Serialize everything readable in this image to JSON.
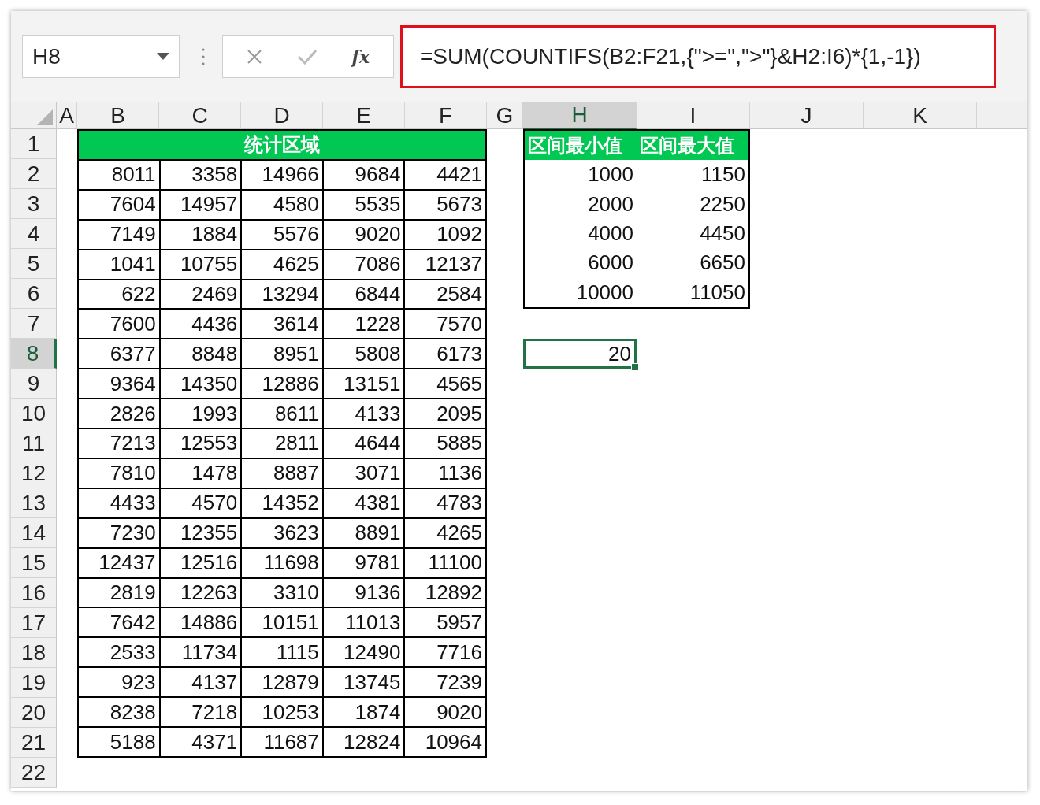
{
  "name_box": {
    "value": "H8"
  },
  "formula_bar": {
    "function_label": "fx",
    "formula": "=SUM(COUNTIFS(B2:F21,{\">=\",\">\"}&H2:I6)*{1,-1})",
    "highlighted": true
  },
  "columns": [
    {
      "label": "A",
      "selected": false
    },
    {
      "label": "B",
      "selected": false
    },
    {
      "label": "C",
      "selected": false
    },
    {
      "label": "D",
      "selected": false
    },
    {
      "label": "E",
      "selected": false
    },
    {
      "label": "F",
      "selected": false
    },
    {
      "label": "G",
      "selected": false
    },
    {
      "label": "H",
      "selected": true
    },
    {
      "label": "I",
      "selected": false
    },
    {
      "label": "J",
      "selected": false
    },
    {
      "label": "K",
      "selected": false
    }
  ],
  "rows": [
    {
      "label": "1",
      "selected": false
    },
    {
      "label": "2",
      "selected": false
    },
    {
      "label": "3",
      "selected": false
    },
    {
      "label": "4",
      "selected": false
    },
    {
      "label": "5",
      "selected": false
    },
    {
      "label": "6",
      "selected": false
    },
    {
      "label": "7",
      "selected": false
    },
    {
      "label": "8",
      "selected": true
    },
    {
      "label": "9",
      "selected": false
    },
    {
      "label": "10",
      "selected": false
    },
    {
      "label": "11",
      "selected": false
    },
    {
      "label": "12",
      "selected": false
    },
    {
      "label": "13",
      "selected": false
    },
    {
      "label": "14",
      "selected": false
    },
    {
      "label": "15",
      "selected": false
    },
    {
      "label": "16",
      "selected": false
    },
    {
      "label": "17",
      "selected": false
    },
    {
      "label": "18",
      "selected": false
    },
    {
      "label": "19",
      "selected": false
    },
    {
      "label": "20",
      "selected": false
    },
    {
      "label": "21",
      "selected": false
    },
    {
      "label": "22",
      "selected": false
    }
  ],
  "data_table": {
    "title": "统计区域",
    "rows": [
      [
        "8011",
        "3358",
        "14966",
        "9684",
        "4421"
      ],
      [
        "7604",
        "14957",
        "4580",
        "5535",
        "5673"
      ],
      [
        "7149",
        "1884",
        "5576",
        "9020",
        "1092"
      ],
      [
        "1041",
        "10755",
        "4625",
        "7086",
        "12137"
      ],
      [
        "622",
        "2469",
        "13294",
        "6844",
        "2584"
      ],
      [
        "7600",
        "4436",
        "3614",
        "1228",
        "7570"
      ],
      [
        "6377",
        "8848",
        "8951",
        "5808",
        "6173"
      ],
      [
        "9364",
        "14350",
        "12886",
        "13151",
        "4565"
      ],
      [
        "2826",
        "1993",
        "8611",
        "4133",
        "2095"
      ],
      [
        "7213",
        "12553",
        "2811",
        "4644",
        "5885"
      ],
      [
        "7810",
        "1478",
        "8887",
        "3071",
        "1136"
      ],
      [
        "4433",
        "4570",
        "14352",
        "4381",
        "4783"
      ],
      [
        "7230",
        "12355",
        "3623",
        "8891",
        "4265"
      ],
      [
        "12437",
        "12516",
        "11698",
        "9781",
        "11100"
      ],
      [
        "2819",
        "12263",
        "3310",
        "9136",
        "12892"
      ],
      [
        "7642",
        "14886",
        "10151",
        "11013",
        "5957"
      ],
      [
        "2533",
        "11734",
        "1115",
        "12490",
        "7716"
      ],
      [
        "923",
        "4137",
        "12879",
        "13745",
        "7239"
      ],
      [
        "8238",
        "7218",
        "10253",
        "1874",
        "9020"
      ],
      [
        "5188",
        "4371",
        "11687",
        "12824",
        "10964"
      ]
    ]
  },
  "range_table": {
    "columns": [
      "区间最小值",
      "区间最大值"
    ],
    "rows": [
      [
        "1000",
        "1150"
      ],
      [
        "2000",
        "2250"
      ],
      [
        "4000",
        "4450"
      ],
      [
        "6000",
        "6650"
      ],
      [
        "10000",
        "11050"
      ]
    ]
  },
  "active_cell": {
    "value": "20"
  }
}
